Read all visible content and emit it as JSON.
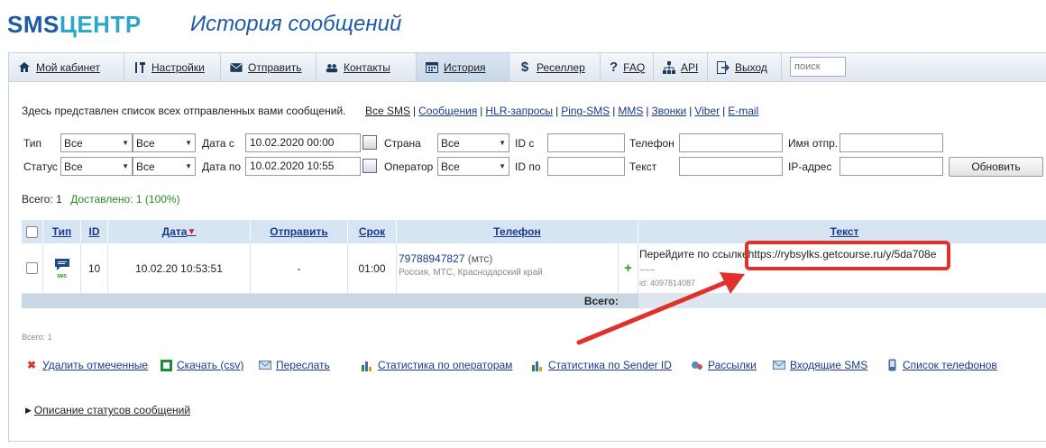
{
  "header": {
    "logo_sms": "SMS",
    "logo_center": "ЦЕНТР",
    "title": "История сообщений"
  },
  "nav": {
    "items": [
      {
        "label": "Мой кабинет"
      },
      {
        "label": "Настройки"
      },
      {
        "label": "Отправить"
      },
      {
        "label": "Контакты"
      },
      {
        "label": "История"
      },
      {
        "label": "Реселлер"
      },
      {
        "label": "FAQ"
      },
      {
        "label": "API"
      },
      {
        "label": "Выход"
      }
    ],
    "search_placeholder": "поиск"
  },
  "description": "Здесь представлен список всех отправленных вами сообщений.",
  "filter_links": [
    "Все SMS",
    "Сообщения",
    "HLR-запросы",
    "Ping-SMS",
    "MMS",
    "Звонки",
    "Viber",
    "E-mail"
  ],
  "filters": {
    "type_label": "Тип",
    "type_value_1": "Все",
    "type_value_2": "Все",
    "status_label": "Статус",
    "status_value_1": "Все",
    "status_value_2": "Все",
    "date_from_label": "Дата с",
    "date_from_value": "10.02.2020 00:00",
    "date_to_label": "Дата по",
    "date_to_value": "10.02.2020 10:55",
    "country_label": "Страна",
    "country_value": "Все",
    "operator_label": "Оператор",
    "operator_value": "Все",
    "id_from_label": "ID с",
    "id_to_label": "ID по",
    "phone_label": "Телефон",
    "text_label": "Текст",
    "sender_label": "Имя отпр.",
    "ip_label": "IP-адрес",
    "refresh_label": "Обновить"
  },
  "totals": {
    "total_label": "Всего:",
    "total_value": "1",
    "delivered": "Доставлено: 1 (100%)"
  },
  "table": {
    "headers": {
      "type": "Тип",
      "id": "ID",
      "date": "Дата",
      "sort_arrow": "▼",
      "send": "Отправить",
      "term": "Срок",
      "phone": "Телефон",
      "text": "Текст"
    },
    "row": {
      "icon_caption": "SMS",
      "id": "10",
      "date": "10.02.20 10:53:51",
      "send": "-",
      "term": "01:00",
      "phone": "79788947827",
      "operator": "(мтс)",
      "region": "Россия, МТС, Краснодарский край",
      "plus": "+",
      "text_prefix": "Перейдите по ссылке",
      "text_url": "https://rybsylks.getcourse.ru/y/5da708e",
      "tilde": "~~~",
      "msg_id": "id: 4097814087"
    },
    "total_label": "Всего:"
  },
  "bottom_total": "Всего: 1",
  "actions": [
    {
      "label": "Удалить отмеченные"
    },
    {
      "label": "Скачать (csv)"
    },
    {
      "label": "Переслать"
    },
    {
      "label": "Статистика по операторам"
    },
    {
      "label": "Статистика по Sender ID"
    },
    {
      "label": "Рассылки"
    },
    {
      "label": "Входящие SMS"
    },
    {
      "label": "Список телефонов"
    }
  ],
  "status_description": "Описание статусов сообщений",
  "colors": {
    "brand_blue": "#1e5aa8",
    "brand_cyan": "#2aa7c9",
    "highlight_red": "#e0322a",
    "delivered_green": "#2a8a2a"
  }
}
